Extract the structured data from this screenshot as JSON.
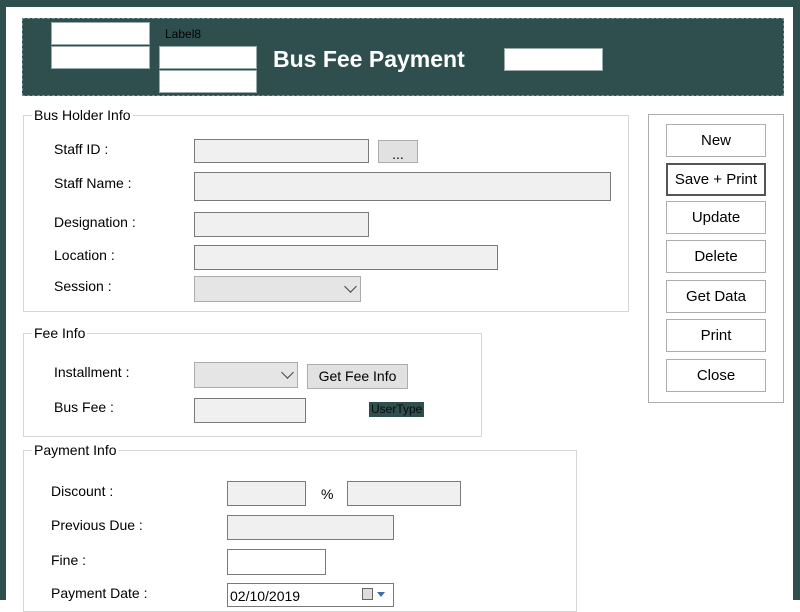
{
  "header": {
    "label8": "Label8",
    "title": "Bus Fee Payment"
  },
  "bus_holder_info": {
    "legend": "Bus Holder Info",
    "staff_id_label": "Staff ID :",
    "browse_button": "...",
    "staff_name_label": "Staff Name :",
    "designation_label": "Designation :",
    "location_label": "Location :",
    "session_label": "Session :"
  },
  "fee_info": {
    "legend": "Fee Info",
    "installment_label": "Installment :",
    "get_fee_info_button": "Get Fee Info",
    "bus_fee_label": "Bus Fee :",
    "user_type": "UserType"
  },
  "payment_info": {
    "legend": "Payment Info",
    "discount_label": "Discount :",
    "percent_sign": "%",
    "previous_due_label": "Previous Due :",
    "fine_label": "Fine :",
    "payment_date_label": "Payment Date :",
    "payment_date_value": "02/10/2019"
  },
  "actions": {
    "new": "New",
    "save_print": "Save + Print",
    "update": "Update",
    "delete": "Delete",
    "get_data": "Get Data",
    "print": "Print",
    "close": "Close"
  },
  "colors": {
    "header_bg": "#2f4f4f",
    "title_text": "#ffffff"
  },
  "icons": {
    "calendar": "calendar-icon",
    "dropdown": "chevron-down-icon"
  }
}
